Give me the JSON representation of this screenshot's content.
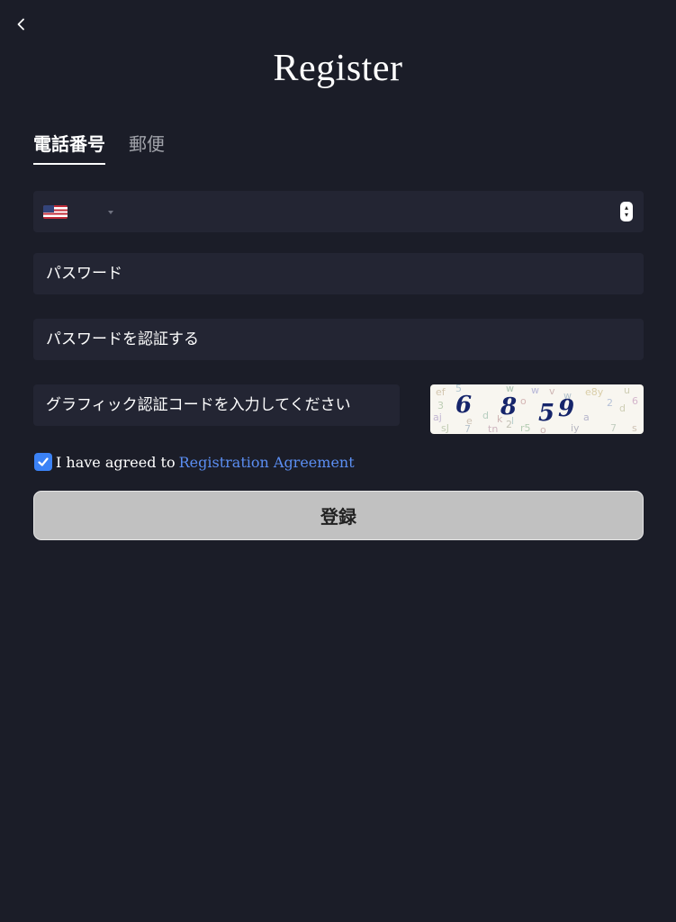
{
  "header": {
    "back_icon": "chevron-left-icon",
    "title": "Register"
  },
  "tabs": [
    {
      "label": "電話番号",
      "active": true
    },
    {
      "label": "郵便",
      "active": false
    }
  ],
  "phone": {
    "country_flag": "us-flag-icon",
    "dropdown_icon": "caret-down-icon",
    "value": ""
  },
  "password": {
    "placeholder": "パスワード"
  },
  "confirm_password": {
    "placeholder": "パスワードを認証する"
  },
  "captcha": {
    "placeholder": "グラフィック認証コードを入力してください",
    "image_code": "6859"
  },
  "agreement": {
    "checked": true,
    "text": "I have agreed to",
    "link_label": "Registration Agreement"
  },
  "submit": {
    "label": "登録"
  },
  "colors": {
    "background": "#1b1d28",
    "field": "#232533",
    "link": "#5b8ef2",
    "checkbox": "#3b82f6",
    "button": "#c1c1c1"
  }
}
